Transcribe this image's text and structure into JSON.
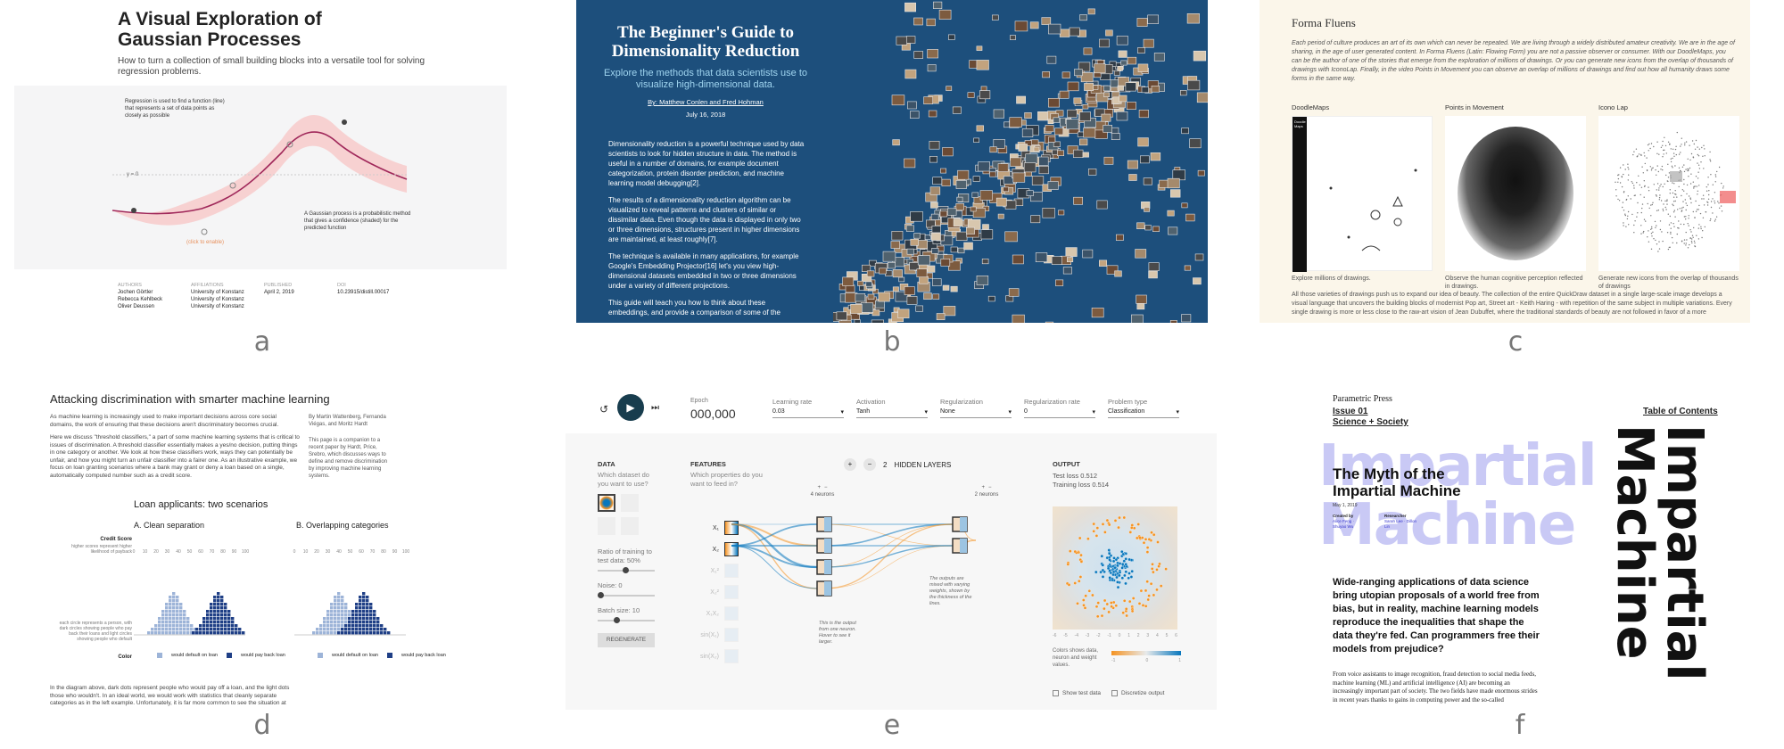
{
  "panel_labels": [
    "a",
    "b",
    "c",
    "d",
    "e",
    "f"
  ],
  "panel_a": {
    "title": "A Visual Exploration of Gaussian Processes",
    "subtitle": "How to turn a collection of small building blocks into a versatile tool for solving regression problems.",
    "regression_note": "Regression is used to find a function (line) that represents a set of data points as closely as possible",
    "y0": "y = 0",
    "gp_note": "A Gaussian process is a probabilistic method that gives a confidence (shaded) for the predicted function",
    "click_note": "(click to enable)",
    "meta": [
      {
        "head": "AUTHORS",
        "lines": [
          "Jochen Görtler",
          "Rebecca Kehlbeck",
          "Oliver Deussen"
        ]
      },
      {
        "head": "AFFILIATIONS",
        "lines": [
          "University of Konstanz",
          "University of Konstanz",
          "University of Konstanz"
        ]
      },
      {
        "head": "PUBLISHED",
        "lines": [
          "April 2, 2019"
        ]
      },
      {
        "head": "DOI",
        "lines": [
          "10.23915/distill.00017"
        ]
      }
    ]
  },
  "panel_b": {
    "title": "The Beginner's Guide to Dimensionality Reduction",
    "subtitle": "Explore the methods that data scientists use to visualize high-dimensional data.",
    "byline": "By: Matthew Conlen and Fred Hohman",
    "date": "July 16, 2018",
    "p1": "Dimensionality reduction is a powerful technique used by data scientists to look for hidden structure in data. The method is useful in a number of domains, for example document categorization, protein disorder prediction, and machine learning model debugging[2].",
    "p2": "The results of a dimensionality reduction algorithm can be visualized to reveal patterns and clusters of similar or dissimilar data. Even though the data is displayed in only two or three dimensions, structures present in higher dimensions are maintained, at least roughly[7].",
    "p3": "The technique is available in many applications, for example Google's Embedding Projector[16] let's you view high-dimensional datasets embedded in two or three dimensions under a variety of different projections.",
    "p4": "This guide will teach you how to think about these embeddings, and provide a comparison of some of the"
  },
  "panel_c": {
    "title": "Forma Fluens",
    "p1": "Each period of culture produces an art of its own which can never be repeated. We are living through a widely distributed amateur creativity. We are in the age of sharing, in the age of user generated content. In Forma Fluens (Latin: Flowing Form) you are not a passive observer or consumer. With our DoodleMaps, you can be the author of one of the stories that emerge from the exploration of millions of drawings. Or you can generate new icons from the overlap of thousands of drawings with IconoLap. Finally, in the video Points in Movement you can observe an overlap of millions of drawings and find out how all humanity draws some forms in the same way.",
    "cols": [
      {
        "title": "DoodleMaps",
        "caption": "Explore millions of drawings."
      },
      {
        "title": "Points in Movement",
        "caption": "Observe the human cognitive perception reflected in drawings."
      },
      {
        "title": "Icono Lap",
        "caption": "Generate new icons from the overlap of thousands of drawings"
      }
    ],
    "doodle_header": "Doodle Maps",
    "p2": "All those varieties of drawings push us to expand our idea of beauty. The collection of the entire QuickDraw dataset in a single large-scale image develops a visual language that uncovers the building blocks of modernist Pop art, Street art - Keith Haring - with repetition of the same subject in multiple variations. Every single drawing is more or less close to the raw-art vision of Jean Dubuffet, where the traditional standards of beauty are not followed in favor of a more"
  },
  "panel_d": {
    "title": "Attacking discrimination with smarter machine learning",
    "p1": "As machine learning is increasingly used to make important decisions across core social domains, the work of ensuring that these decisions aren't discriminatory becomes crucial.",
    "p2": "Here we discuss \"threshold classifiers,\" a part of some machine learning systems that is critical to issues of discrimination. A threshold classifier essentially makes a yes/no decision, putting things in one category or another. We look at how these classifiers work, ways they can potentially be unfair, and how you might turn an unfair classifier into a fairer one. As an illustrative example, we focus on loan granting scenarios where a bank may grant or deny a loan based on a single, automatically computed number such as a credit score.",
    "side1": "By Martin Wattenberg, Fernanda Viégas, and Moritz Hardt",
    "side2": "This page is a companion to a recent paper by Hardt, Price, Srebro, which discusses ways to define and remove discrimination by improving machine learning systems.",
    "chart_title": "Loan applicants: two scenarios",
    "sub_a": "A. Clean separation",
    "sub_b": "B. Overlapping categories",
    "credit_label": "Credit Score",
    "credit_sub": "higher scores represent higher likelihood of payback",
    "ticks": [
      "0",
      "10",
      "20",
      "30",
      "40",
      "50",
      "60",
      "70",
      "80",
      "90",
      "100"
    ],
    "circle_note": "each circle represents a person, with dark circles showing people who pay back their loans and light circles showing people who default",
    "color_label": "Color",
    "legend_light": "would default on loan",
    "legend_dark": "would pay back loan",
    "p3": "In the diagram above, dark dots represent people who would pay off a loan, and the light dots those who wouldn't. In an ideal world, we would work with statistics that cleanly separate categories as in the left example. Unfortunately, it is far more common to see the situation at",
    "colors": {
      "light": "#9db4d8",
      "dark": "#1f3f86"
    }
  },
  "panel_e": {
    "epoch_label": "Epoch",
    "epoch_value": "000,000",
    "controls": [
      {
        "label": "Learning rate",
        "value": "0.03"
      },
      {
        "label": "Activation",
        "value": "Tanh"
      },
      {
        "label": "Regularization",
        "value": "None"
      },
      {
        "label": "Regularization rate",
        "value": "0"
      },
      {
        "label": "Problem type",
        "value": "Classification"
      }
    ],
    "data_title": "DATA",
    "data_q": "Which dataset do you want to use?",
    "ratio_label": "Ratio of training to test data: 50%",
    "noise_label": "Noise: 0",
    "batch_label": "Batch size: 10",
    "regen": "REGENERATE",
    "features_title": "FEATURES",
    "features_q": "Which properties do you want to feed in?",
    "feature_names": [
      "X₁",
      "X₂",
      "X₁²",
      "X₂²",
      "X₁X₂",
      "sin(X₁)",
      "sin(X₂)"
    ],
    "hidden_count": "2",
    "hidden_label": "HIDDEN LAYERS",
    "layer1_neurons": "4 neurons",
    "layer2_neurons": "2 neurons",
    "note_output": "This is the output from one neuron. Hover to see it larger.",
    "note_weights": "The outputs are mixed with varying weights, shown by the thickness of the lines.",
    "output_title": "OUTPUT",
    "test_loss": "Test loss 0.512",
    "train_loss": "Training loss 0.514",
    "colors_note": "Colors shows data, neuron and weight values.",
    "show_test": "Show test data",
    "discretize": "Discretize output",
    "scale_ticks": [
      "-1",
      "0",
      "1"
    ],
    "axis_ticks": [
      "-6",
      "-5",
      "-4",
      "-3",
      "-2",
      "-1",
      "0",
      "1",
      "2",
      "3",
      "4",
      "5",
      "6"
    ],
    "colors": {
      "orange": "#f59322",
      "blue": "#0877bd"
    }
  },
  "panel_f": {
    "brand": "Parametric Press",
    "issue": "Issue 01",
    "section": "Science + Society",
    "toc": "Table of Contents",
    "bg_word1": "Impartial",
    "bg_word2": "Machine",
    "title": "The Myth of the Impartial Machine",
    "date": "May 1, 2019",
    "credit_head1": "Created by",
    "credit_names1": "Alice Feng · Shuyao Wu",
    "credit_head2": "Researcher",
    "credit_names2": "Sarah Lee · Dillon Lin",
    "lead": "Wide-ranging applications of data science bring utopian proposals of a world free from bias, but in reality, machine learning models reproduce the inequalities that shape the data they're fed. Can programmers free their models from prejudice?",
    "body": "From voice assistants to image recognition, fraud detection to social media feeds, machine learning (ML) and artificial intelligence (AI) are becoming an increasingly important part of society. The two fields have made enormous strides in recent years thanks to gains in computing power and the so-called",
    "vertical1": "Impartial",
    "vertical2": "Machine",
    "colors": {
      "lavender": "#c9c9f5"
    }
  }
}
